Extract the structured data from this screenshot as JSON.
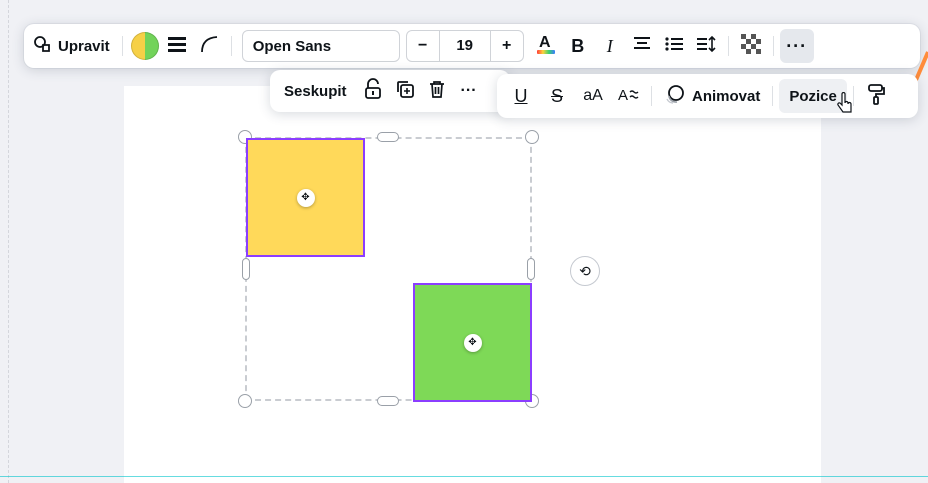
{
  "toolbar": {
    "edit_label": "Upravit",
    "font_name": "Open Sans",
    "font_size": "19",
    "minus": "−",
    "plus": "+",
    "more": "···"
  },
  "sub_toolbar_left": {
    "group_label": "Seskupit",
    "more": "···"
  },
  "sub_toolbar_right": {
    "animate_label": "Animovat",
    "position_label": "Pozice",
    "case_label": "aA"
  },
  "colors": {
    "accent": "#8b3dff",
    "yellow_shape": "#ffd95a",
    "green_shape": "#7ed957",
    "swatch_left": "#f6d047",
    "swatch_right": "#72d35a",
    "text_color_underline": "rainbow"
  },
  "icons": [
    "search-edit-icon",
    "line-weight-icon",
    "corner-curve-icon",
    "text-color-icon",
    "bold-icon",
    "italic-icon",
    "align-center-icon",
    "list-icon",
    "spacing-icon",
    "transparency-icon",
    "unlock-icon",
    "duplicate-icon",
    "trash-icon",
    "underline-icon",
    "strikethrough-icon",
    "font-effects-icon",
    "animate-icon",
    "paint-roller-icon",
    "rotate-icon",
    "move-icon"
  ]
}
